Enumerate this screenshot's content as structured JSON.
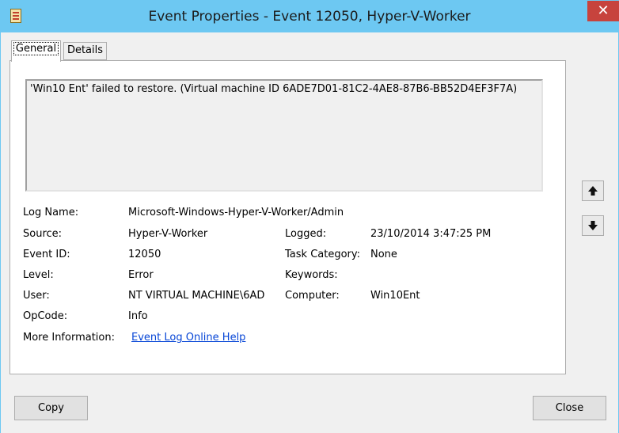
{
  "window": {
    "title": "Event Properties - Event 12050, Hyper-V-Worker",
    "close_glyph": "✕"
  },
  "tabs": [
    "General",
    "Details"
  ],
  "description": "'Win10 Ent' failed to restore. (Virtual machine ID 6ADE7D01-81C2-4AE8-87B6-BB52D4EF3F7A)",
  "fields": {
    "log_name": {
      "label": "Log Name:",
      "value": "Microsoft-Windows-Hyper-V-Worker/Admin"
    },
    "source": {
      "label": "Source:",
      "value": "Hyper-V-Worker"
    },
    "logged": {
      "label": "Logged:",
      "value": "23/10/2014 3:47:25 PM"
    },
    "event_id": {
      "label": "Event ID:",
      "value": "12050"
    },
    "task_category": {
      "label": "Task Category:",
      "value": "None"
    },
    "level": {
      "label": "Level:",
      "value": "Error"
    },
    "keywords": {
      "label": "Keywords:",
      "value": ""
    },
    "user": {
      "label": "User:",
      "value": "NT VIRTUAL MACHINE\\6AD"
    },
    "computer": {
      "label": "Computer:",
      "value": "Win10Ent"
    },
    "opcode": {
      "label": "OpCode:",
      "value": "Info"
    },
    "more_info": {
      "label": "More Information:",
      "link": "Event Log Online Help"
    }
  },
  "nav": {
    "up_icon": "up-arrow-icon",
    "down_icon": "down-arrow-icon"
  },
  "buttons": {
    "copy": "Copy",
    "close": "Close"
  },
  "colors": {
    "titlebar": "#6dc8f2",
    "close_button": "#c7433d",
    "link": "#0645d6"
  }
}
